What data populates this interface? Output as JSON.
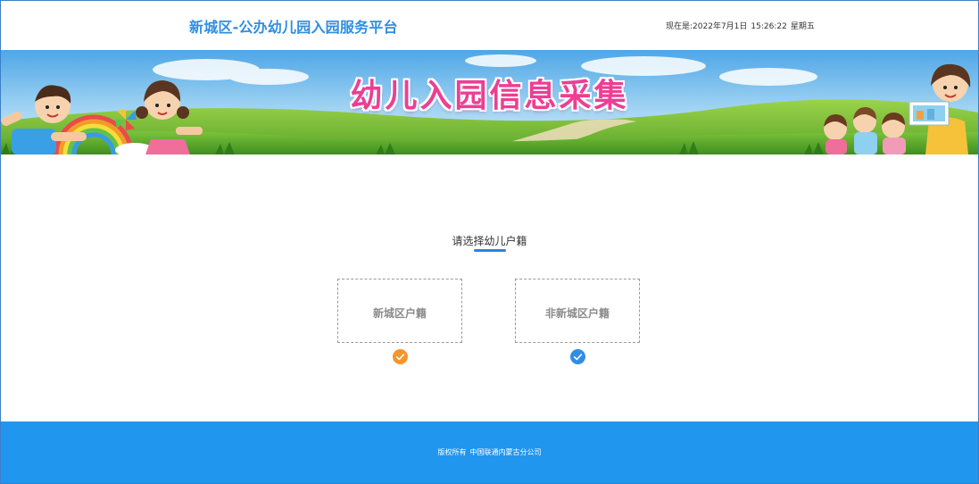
{
  "header": {
    "title": "新城区-公办幼儿园入园服务平台",
    "clock_prefix": "现在是:",
    "date": "2022年7月1日",
    "time": "15:26:22",
    "weekday": "星期五"
  },
  "banner": {
    "title": "幼儿入园信息采集"
  },
  "main": {
    "prompt": "请选择幼儿户籍",
    "options": [
      {
        "label": "新城区户籍",
        "check_icon": "check-circle-icon",
        "check_color": "#f5952a"
      },
      {
        "label": "非新城区户籍",
        "check_icon": "check-circle-icon",
        "check_color": "#2e8de6"
      }
    ]
  },
  "footer": {
    "copyright_label": "版权所有",
    "company": "中国联通内蒙古分公司"
  },
  "colors": {
    "accent": "#2f8ee0",
    "footer_bg": "#2196ef",
    "banner_title": "#ec3f94"
  }
}
